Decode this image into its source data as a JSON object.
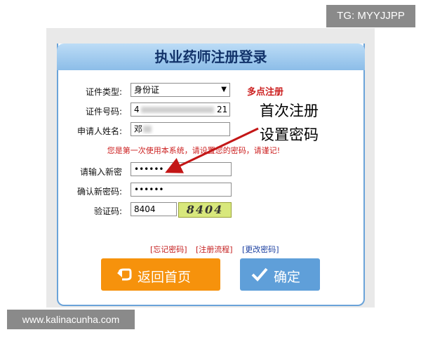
{
  "watermark_top": "TG: MYYJJPP",
  "watermark_bottom": "www.kalinacunha.com",
  "panel": {
    "title": "执业药师注册登录"
  },
  "form": {
    "cert_type_label": "证件类型:",
    "cert_type_value": "身份证",
    "cert_number_label": "证件号码:",
    "cert_number_prefix": "4",
    "cert_number_suffix": "21",
    "name_label": "申请人姓名:",
    "name_value": "邓",
    "hint": "您是第一次使用本系统，请设置您的密码，请谨记!",
    "new_password_label": "请输入新密",
    "new_password_value": "••••••",
    "confirm_password_label": "确认新密码:",
    "confirm_password_value": "••••••",
    "captcha_label": "验证码:",
    "captcha_input_value": "8404",
    "captcha_image_text": "8404"
  },
  "annotation": {
    "multi_register": "多点注册",
    "first_register": "首次注册",
    "set_password": "设置密码"
  },
  "links": {
    "forgot_password": "[忘记密码]",
    "register_flow": "[注册流程]",
    "change_password": "[更改密码]"
  },
  "buttons": {
    "back_home": "返回首页",
    "confirm": "确定"
  },
  "colors": {
    "accent_red": "#cc1f1f",
    "orange": "#f6920c",
    "blue": "#5f9fd9",
    "header": "#8cbde8"
  }
}
